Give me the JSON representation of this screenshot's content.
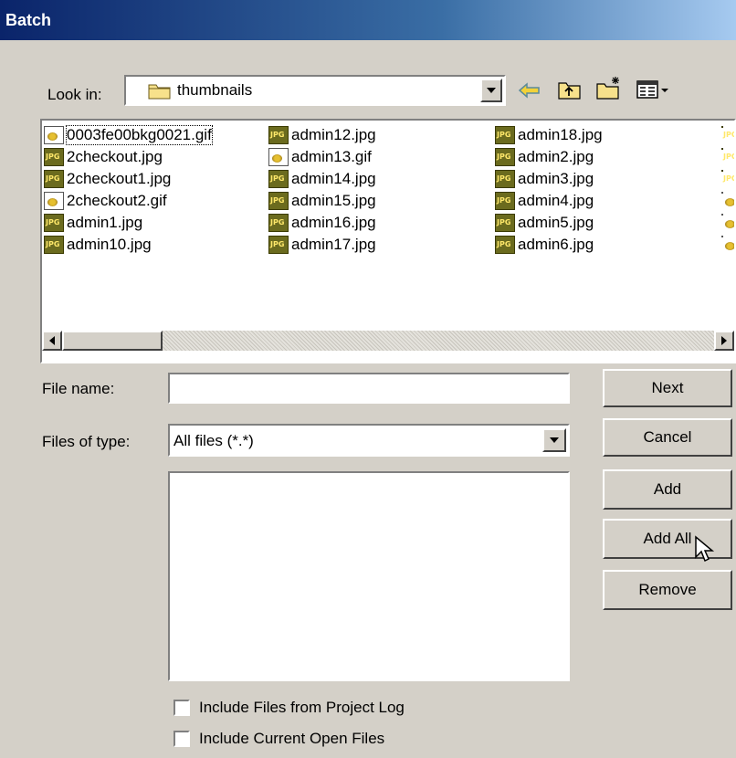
{
  "window": {
    "title": "Batch"
  },
  "look_in": {
    "label": "Look in:",
    "value": "thumbnails",
    "toolbar_icons": [
      "back-arrow-icon",
      "up-folder-icon",
      "new-folder-icon",
      "view-menu-icon"
    ]
  },
  "files": {
    "columns": [
      [
        "0003fe00bkg0021.gif",
        "2checkout.jpg",
        "2checkout1.jpg",
        "2checkout2.gif",
        "admin1.jpg",
        "admin10.jpg"
      ],
      [
        "admin12.jpg",
        "admin13.gif",
        "admin14.jpg",
        "admin15.jpg",
        "admin16.jpg",
        "admin17.jpg"
      ],
      [
        "admin18.jpg",
        "admin2.jpg",
        "admin3.jpg",
        "admin4.jpg",
        "admin5.jpg",
        "admin6.jpg"
      ]
    ]
  },
  "file_name": {
    "label": "File name:",
    "value": ""
  },
  "files_of_type": {
    "label": "Files of type:",
    "value": "All files (*.*)"
  },
  "buttons": {
    "next": "Next",
    "cancel": "Cancel",
    "add": "Add",
    "add_all": "Add All",
    "remove": "Remove"
  },
  "options": {
    "include_project_log": {
      "label": "Include Files from Project Log",
      "checked": false
    },
    "include_open_files": {
      "label": "Include Current Open Files",
      "checked": false
    }
  }
}
